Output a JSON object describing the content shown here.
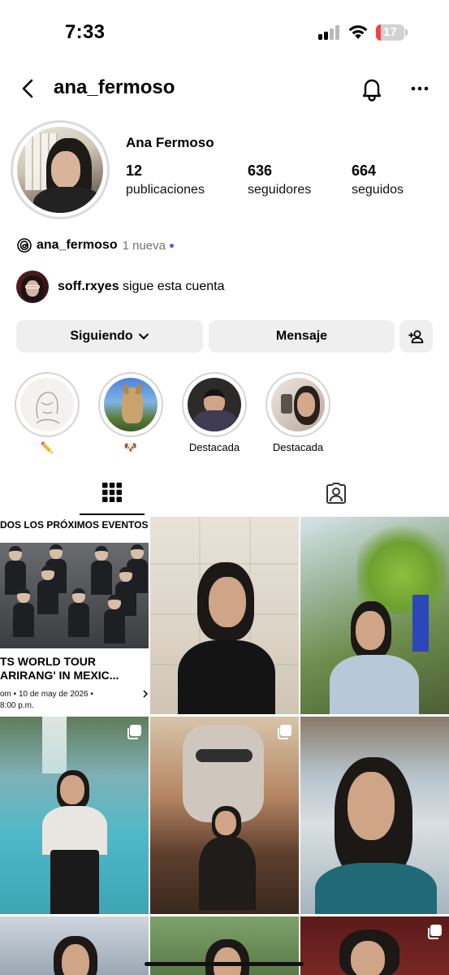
{
  "status_bar": {
    "time": "7:33",
    "battery": "17",
    "battery_level": 0.17,
    "signal_bars": 2
  },
  "header": {
    "username": "ana_fermoso",
    "back_icon": "chevron-left-icon",
    "notifications_icon": "bell-icon",
    "more_icon": "more-horizontal-icon"
  },
  "profile": {
    "display_name": "Ana Fermoso",
    "stats": [
      {
        "value": "12",
        "label": "publicaciones"
      },
      {
        "value": "636",
        "label": "seguidores"
      },
      {
        "value": "664",
        "label": "seguidos"
      }
    ],
    "threads": {
      "handle": "ana_fermoso",
      "badge": "1 nueva",
      "icon": "threads-icon",
      "dot_color": "#4a5bf5"
    },
    "followed_by": {
      "user": "soff.rxyes",
      "text": "sigue esta cuenta"
    }
  },
  "actions": {
    "follow_label": "Siguiendo",
    "message_label": "Mensaje",
    "add_icon": "add-person-icon"
  },
  "highlights": [
    {
      "label": "✏️"
    },
    {
      "label": "🐶"
    },
    {
      "label": "Destacada"
    },
    {
      "label": "Destacada"
    }
  ],
  "tabs": [
    {
      "name": "grid",
      "icon": "grid-icon",
      "active": true
    },
    {
      "name": "tagged",
      "icon": "tagged-person-icon",
      "active": false
    }
  ],
  "posts": {
    "event_post": {
      "banner": "DOS LOS PRÓXIMOS EVENTOS",
      "title_line1": "TS WORLD TOUR",
      "title_line2": "ARIRANG' IN MEXIC...",
      "meta_line1": "om • 10 de may de 2026 •",
      "meta_line2": "8:00 p.m."
    },
    "multi_icon": "carousel-icon"
  },
  "colors": {
    "button_bg": "#efefef",
    "ring": "#dbdbdb",
    "muted_text": "#737373"
  }
}
